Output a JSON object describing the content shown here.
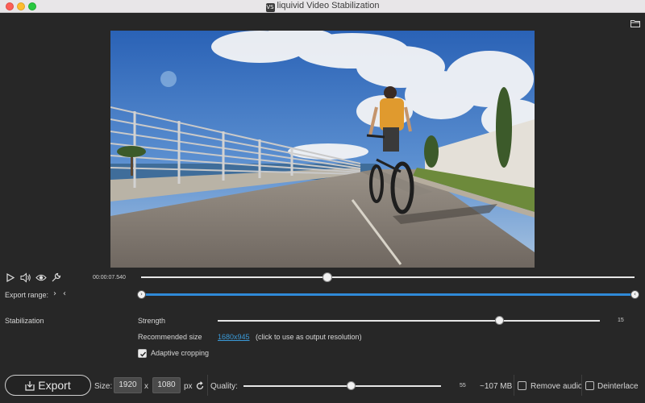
{
  "window": {
    "title": "liquivid Video Stabilization",
    "app_icon_text": "VS"
  },
  "player": {
    "timecode": "00:00:07.540",
    "playhead_fraction": 0.378
  },
  "export_range": {
    "label": "Export range:",
    "start_fraction": 0.0,
    "end_fraction": 1.0
  },
  "stabilization": {
    "section_label": "Stabilization",
    "strength_label": "Strength",
    "strength_value": "15",
    "recommended_label": "Recommended size",
    "recommended_link": "1680x945",
    "recommended_hint": "(click to use as output resolution)",
    "adaptive_cropping_label": "Adaptive cropping",
    "adaptive_cropping_checked": true
  },
  "export": {
    "button_label": "Export",
    "size_label": "Size:",
    "width": "1920",
    "x_sep": "x",
    "height": "1080",
    "unit": "px",
    "quality_label": "Quality:",
    "quality_value": "55",
    "estimated_size": "~107 MB",
    "remove_audio_label": "Remove audio",
    "deinterlace_label": "Deinterlace"
  },
  "icons": [
    "play-icon",
    "speaker-icon",
    "eye-icon",
    "wrench-icon",
    "folder-icon",
    "export-icon",
    "reset-icon"
  ],
  "colors": {
    "background": "#272727",
    "accent": "#2f8ad8",
    "link": "#3a9ad9"
  }
}
